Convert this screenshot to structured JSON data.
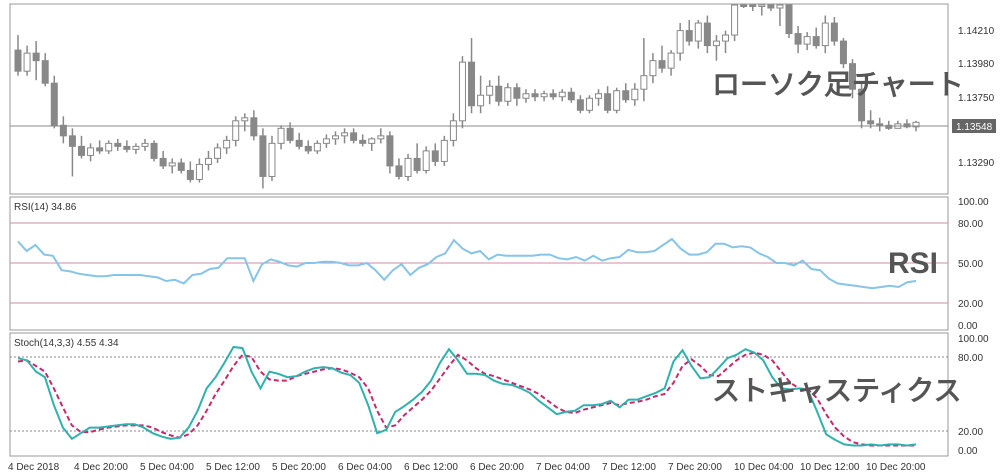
{
  "overlays": {
    "candlestick": "ローソク足チャート",
    "rsi": "RSI",
    "stochastic": "ストキャスティクス"
  },
  "price_panel": {
    "ticks": [
      "1.14210",
      "1.13980",
      "1.13750",
      "1.13290"
    ],
    "current_price": "1.13548",
    "colors": {
      "candle": "#888888",
      "frame": "#999999",
      "price_line": "#888888",
      "badge_bg": "#666666",
      "badge_text": "#ffffff"
    }
  },
  "rsi_panel": {
    "label": "RSI(14) 34.86",
    "ticks": [
      "100.00",
      "80.00",
      "50.00",
      "20.00",
      "0.00"
    ],
    "levels": [
      80,
      50,
      20
    ],
    "colors": {
      "line": "#87c4e6",
      "level": "#d48aa6"
    }
  },
  "stoch_panel": {
    "label": "Stoch(14,3,3) 4.55 4.34",
    "ticks": [
      "100.00",
      "80.00",
      "20.00",
      "0.00"
    ],
    "levels": [
      80,
      20
    ],
    "colors": {
      "main": "#2fb1ad",
      "signal": "#c8286e",
      "level": "#888888"
    }
  },
  "time_axis": {
    "labels": [
      "4 Dec 2018",
      "4 Dec 20:00",
      "5 Dec 04:00",
      "5 Dec 12:00",
      "5 Dec 20:00",
      "6 Dec 04:00",
      "6 Dec 12:00",
      "6 Dec 20:00",
      "7 Dec 04:00",
      "7 Dec 12:00",
      "7 Dec 20:00",
      "10 Dec 04:00",
      "10 Dec 12:00",
      "10 Dec 20:00"
    ]
  },
  "chart_data": [
    {
      "type": "candlestick",
      "ylim": [
        1.1307,
        1.1432
      ],
      "ohlc": [
        [
          1.1402,
          1.1412,
          1.1385,
          1.1388
        ],
        [
          1.1388,
          1.1405,
          1.1385,
          1.14
        ],
        [
          1.14,
          1.1408,
          1.1382,
          1.1395
        ],
        [
          1.1395,
          1.14,
          1.1378,
          1.138
        ],
        [
          1.138,
          1.1385,
          1.135,
          1.1352
        ],
        [
          1.1352,
          1.1358,
          1.134,
          1.1345
        ],
        [
          1.1345,
          1.135,
          1.1318,
          1.1338
        ],
        [
          1.1338,
          1.1345,
          1.133,
          1.1332
        ],
        [
          1.1332,
          1.134,
          1.1328,
          1.1337
        ],
        [
          1.1337,
          1.1342,
          1.1333,
          1.1335
        ],
        [
          1.1335,
          1.1342,
          1.1333,
          1.134
        ],
        [
          1.134,
          1.1343,
          1.1335,
          1.1338
        ],
        [
          1.1338,
          1.1342,
          1.1334,
          1.1336
        ],
        [
          1.1336,
          1.134,
          1.1333,
          1.1338
        ],
        [
          1.1338,
          1.1343,
          1.1335,
          1.134
        ],
        [
          1.134,
          1.1342,
          1.1328,
          1.133
        ],
        [
          1.133,
          1.1335,
          1.1323,
          1.1325
        ],
        [
          1.1325,
          1.133,
          1.132,
          1.1327
        ],
        [
          1.1327,
          1.133,
          1.132,
          1.1322
        ],
        [
          1.1322,
          1.1328,
          1.1314,
          1.1316
        ],
        [
          1.1316,
          1.133,
          1.1314,
          1.1326
        ],
        [
          1.1326,
          1.1335,
          1.1322,
          1.133
        ],
        [
          1.133,
          1.134,
          1.1327,
          1.1337
        ],
        [
          1.1337,
          1.1345,
          1.1333,
          1.1342
        ],
        [
          1.1342,
          1.1358,
          1.1338,
          1.1355
        ],
        [
          1.1355,
          1.136,
          1.1348,
          1.1357
        ],
        [
          1.1357,
          1.1362,
          1.1342,
          1.1345
        ],
        [
          1.1345,
          1.135,
          1.131,
          1.1318
        ],
        [
          1.1318,
          1.1345,
          1.1315,
          1.134
        ],
        [
          1.134,
          1.1352,
          1.1336,
          1.135
        ],
        [
          1.135,
          1.1354,
          1.134,
          1.1342
        ],
        [
          1.1342,
          1.1347,
          1.1336,
          1.1338
        ],
        [
          1.1338,
          1.1342,
          1.1333,
          1.1335
        ],
        [
          1.1335,
          1.1342,
          1.1333,
          1.134
        ],
        [
          1.134,
          1.1346,
          1.1337,
          1.1343
        ],
        [
          1.1343,
          1.1348,
          1.1339,
          1.1345
        ],
        [
          1.1345,
          1.135,
          1.134,
          1.1347
        ],
        [
          1.1347,
          1.135,
          1.134,
          1.1342
        ],
        [
          1.1342,
          1.1346,
          1.1338,
          1.134
        ],
        [
          1.134,
          1.1344,
          1.1335,
          1.1343
        ],
        [
          1.1343,
          1.135,
          1.134,
          1.1345
        ],
        [
          1.1345,
          1.1348,
          1.132,
          1.1325
        ],
        [
          1.1325,
          1.133,
          1.1316,
          1.1318
        ],
        [
          1.1318,
          1.1333,
          1.1315,
          1.133
        ],
        [
          1.133,
          1.134,
          1.132,
          1.1322
        ],
        [
          1.1322,
          1.1338,
          1.132,
          1.1335
        ],
        [
          1.1335,
          1.134,
          1.1325,
          1.1328
        ],
        [
          1.1328,
          1.1345,
          1.1325,
          1.1342
        ],
        [
          1.1342,
          1.136,
          1.1338,
          1.1355
        ],
        [
          1.1355,
          1.1398,
          1.135,
          1.1394
        ],
        [
          1.1394,
          1.141,
          1.136,
          1.1365
        ],
        [
          1.1365,
          1.1385,
          1.136,
          1.1372
        ],
        [
          1.1372,
          1.1382,
          1.1366,
          1.1378
        ],
        [
          1.1378,
          1.1385,
          1.1365,
          1.1368
        ],
        [
          1.1368,
          1.138,
          1.1365,
          1.1377
        ],
        [
          1.1377,
          1.138,
          1.1365,
          1.137
        ],
        [
          1.137,
          1.1376,
          1.1367,
          1.1373
        ],
        [
          1.1373,
          1.1376,
          1.1368,
          1.1371
        ],
        [
          1.1371,
          1.1375,
          1.1368,
          1.1373
        ],
        [
          1.1373,
          1.1376,
          1.1369,
          1.1371
        ],
        [
          1.1371,
          1.1376,
          1.1368,
          1.1374
        ],
        [
          1.1374,
          1.1377,
          1.1367,
          1.1369
        ],
        [
          1.1369,
          1.1372,
          1.136,
          1.1362
        ],
        [
          1.1362,
          1.1372,
          1.136,
          1.137
        ],
        [
          1.137,
          1.1376,
          1.1365,
          1.1373
        ],
        [
          1.1373,
          1.1378,
          1.136,
          1.1362
        ],
        [
          1.1362,
          1.1377,
          1.136,
          1.1375
        ],
        [
          1.1375,
          1.138,
          1.1367,
          1.1369
        ],
        [
          1.1369,
          1.138,
          1.1365,
          1.1376
        ],
        [
          1.1376,
          1.141,
          1.1368,
          1.1385
        ],
        [
          1.1385,
          1.14,
          1.138,
          1.1395
        ],
        [
          1.1395,
          1.1405,
          1.1387,
          1.139
        ],
        [
          1.139,
          1.1402,
          1.1385,
          1.14
        ],
        [
          1.14,
          1.142,
          1.1395,
          1.1415
        ],
        [
          1.1415,
          1.1422,
          1.1405,
          1.1408
        ],
        [
          1.1408,
          1.1422,
          1.1403,
          1.142
        ],
        [
          1.142,
          1.1425,
          1.14,
          1.1405
        ],
        [
          1.1405,
          1.1412,
          1.1395,
          1.1408
        ],
        [
          1.1408,
          1.1415,
          1.14,
          1.1412
        ],
        [
          1.1412,
          1.144,
          1.1408,
          1.1438
        ],
        [
          1.1438,
          1.1442,
          1.143,
          1.1435
        ],
        [
          1.1435,
          1.144,
          1.1428,
          1.1432
        ],
        [
          1.1432,
          1.144,
          1.1425,
          1.1437
        ],
        [
          1.1437,
          1.1442,
          1.1428,
          1.143
        ],
        [
          1.143,
          1.1437,
          1.1418,
          1.1433
        ],
        [
          1.1433,
          1.1437,
          1.141,
          1.1413
        ],
        [
          1.1413,
          1.1418,
          1.14,
          1.1406
        ],
        [
          1.1406,
          1.1414,
          1.1402,
          1.1411
        ],
        [
          1.1411,
          1.1417,
          1.1403,
          1.1405
        ],
        [
          1.1405,
          1.1425,
          1.14,
          1.142
        ],
        [
          1.142,
          1.1424,
          1.1405,
          1.1408
        ],
        [
          1.1408,
          1.141,
          1.139,
          1.1393
        ],
        [
          1.1393,
          1.1396,
          1.137,
          1.1376
        ],
        [
          1.1376,
          1.138,
          1.135,
          1.1355
        ],
        [
          1.1355,
          1.1362,
          1.135,
          1.1353
        ],
        [
          1.1353,
          1.1357,
          1.1348,
          1.1352
        ],
        [
          1.1352,
          1.1355,
          1.1349,
          1.135
        ],
        [
          1.135,
          1.1355,
          1.135,
          1.1353
        ],
        [
          1.1353,
          1.1356,
          1.135,
          1.1351
        ],
        [
          1.1351,
          1.1355,
          1.1348,
          1.1354
        ]
      ]
    },
    {
      "type": "line",
      "title": "RSI(14) 34.86",
      "ylim": [
        0,
        100
      ],
      "series": [
        {
          "values": [
            68,
            60,
            65,
            57,
            56,
            44,
            43,
            41,
            40,
            39,
            39,
            40,
            40,
            40,
            40,
            39,
            38,
            35,
            36,
            33,
            40,
            41,
            45,
            46,
            54,
            54,
            54,
            35,
            49,
            53,
            51,
            48,
            47,
            50,
            50,
            51,
            51,
            50,
            48,
            48,
            50,
            44,
            36,
            44,
            49,
            40,
            46,
            49,
            55,
            58,
            69,
            62,
            58,
            60,
            53,
            57,
            56,
            56,
            56,
            56,
            57,
            57,
            54,
            53,
            55,
            52,
            56,
            52,
            54,
            55,
            61,
            59,
            59,
            60,
            65,
            70,
            62,
            57,
            57,
            59,
            66,
            66,
            63,
            64,
            63,
            58,
            55,
            50,
            50,
            48,
            52,
            45,
            44,
            37,
            33,
            32,
            31,
            30,
            29,
            30,
            31,
            30,
            34,
            35
          ]
        }
      ]
    },
    {
      "type": "line",
      "title": "Stoch(14,3,3) 4.55 4.34",
      "ylim": [
        0,
        100
      ],
      "series": [
        {
          "values": [
            82,
            80,
            70,
            65,
            40,
            20,
            10,
            15,
            20,
            20,
            21,
            22,
            23,
            23,
            20,
            15,
            12,
            10,
            11,
            20,
            35,
            55,
            65,
            78,
            92,
            91,
            70,
            55,
            70,
            68,
            65,
            66,
            70,
            73,
            74,
            73,
            69,
            67,
            60,
            40,
            15,
            18,
            34,
            39,
            45,
            52,
            62,
            78,
            90,
            80,
            68,
            68,
            67,
            62,
            59,
            58,
            55,
            51,
            44,
            38,
            32,
            34,
            35,
            40,
            40,
            41,
            44,
            38,
            45,
            45,
            48,
            51,
            55,
            79,
            89,
            75,
            64,
            65,
            73,
            82,
            85,
            90,
            87,
            80,
            65,
            55,
            54,
            55,
            53,
            34,
            14,
            9,
            5,
            4,
            4,
            5,
            4,
            5,
            5,
            4,
            5
          ]
        },
        {
          "values": [
            79,
            80,
            75,
            70,
            55,
            38,
            22,
            16,
            16,
            18,
            20,
            21,
            22,
            22,
            22,
            20,
            16,
            13,
            11,
            14,
            22,
            35,
            50,
            62,
            75,
            85,
            83,
            70,
            63,
            62,
            62,
            66,
            68,
            70,
            72,
            73,
            72,
            69,
            65,
            55,
            35,
            20,
            22,
            31,
            38,
            45,
            53,
            64,
            75,
            85,
            80,
            73,
            68,
            66,
            63,
            60,
            57,
            54,
            50,
            44,
            38,
            34,
            33,
            36,
            38,
            40,
            42,
            40,
            42,
            43,
            45,
            48,
            50,
            60,
            75,
            81,
            75,
            67,
            66,
            73,
            80,
            85,
            87,
            85,
            80,
            70,
            60,
            55,
            54,
            46,
            32,
            20,
            12,
            7,
            5,
            4,
            4,
            4,
            4,
            4,
            4
          ]
        }
      ]
    }
  ]
}
